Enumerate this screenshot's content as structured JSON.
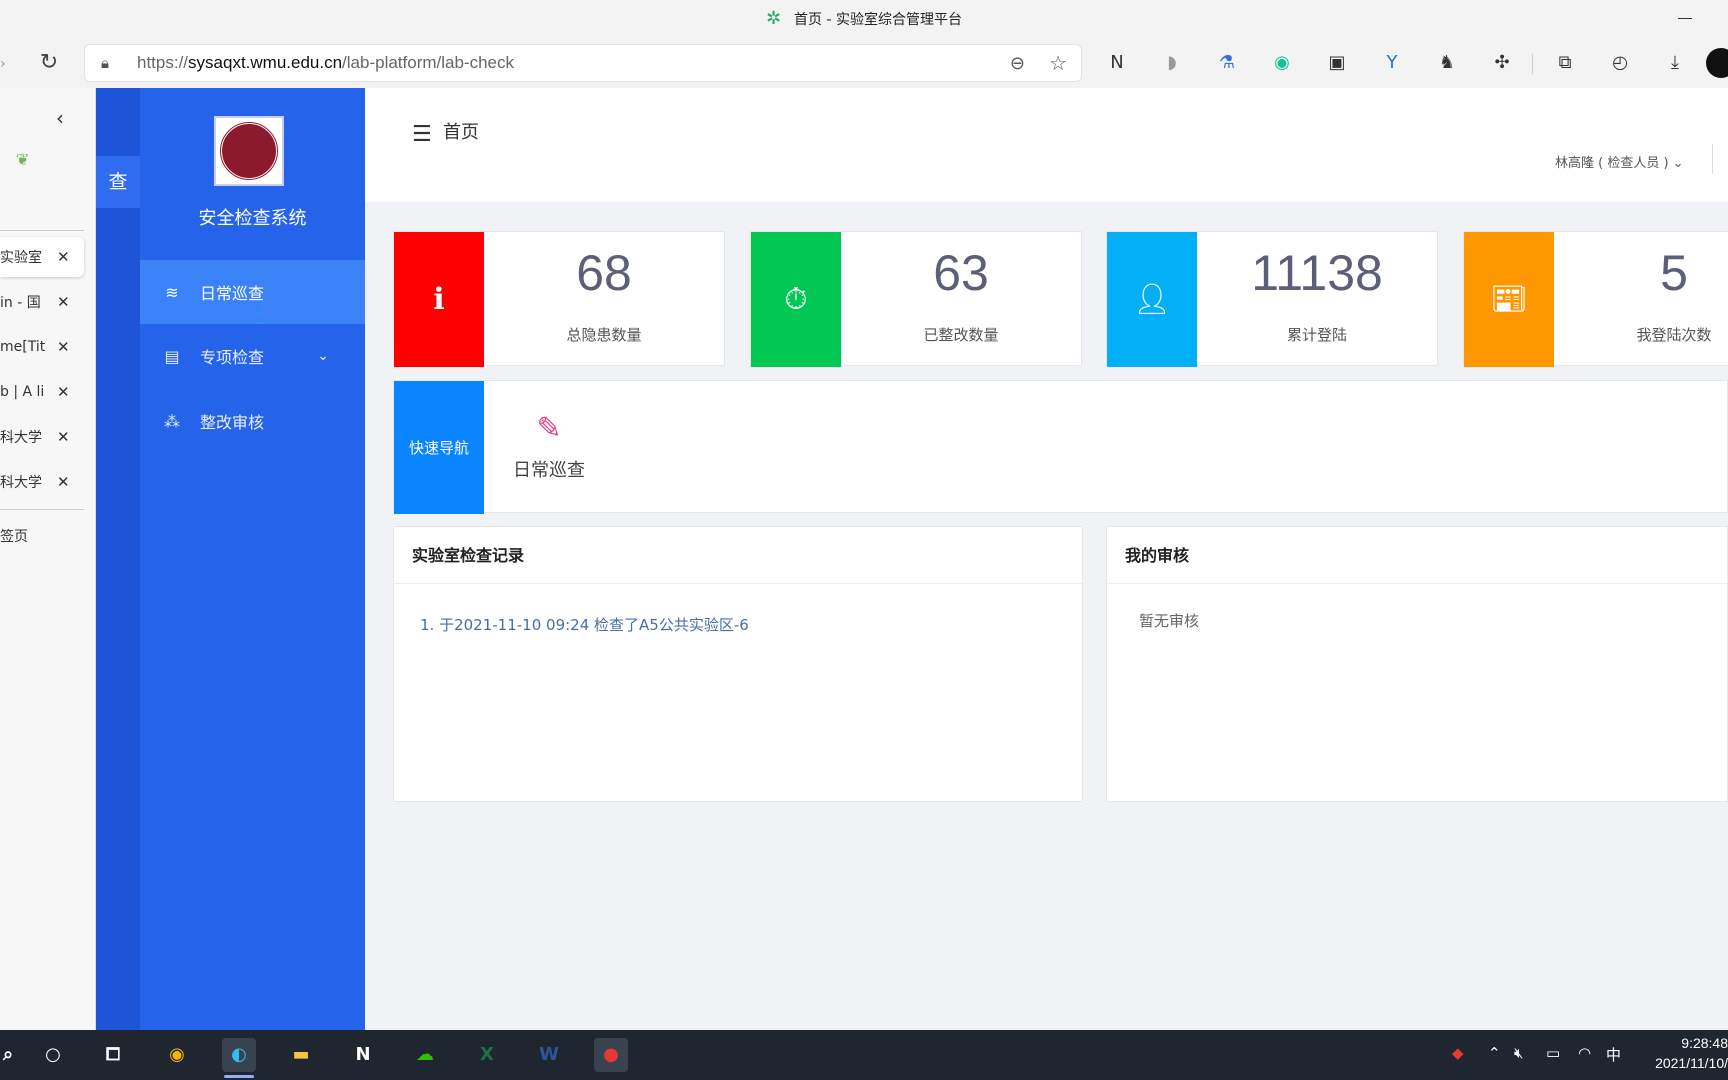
{
  "window": {
    "title": "首页 - 实验室综合管理平台"
  },
  "browser": {
    "url_prefix": "https://",
    "url_host": "sysaqxt.wmu.edu.cn",
    "url_path": "/lab-platform/lab-check"
  },
  "vertical_tabs": [
    {
      "label": "实验室",
      "active": true
    },
    {
      "label": "in - 国"
    },
    {
      "label": "me[Tit"
    },
    {
      "label": "b | A li"
    },
    {
      "label": "科大学"
    },
    {
      "label": "科大学"
    }
  ],
  "new_tab_label": "签页",
  "strip": {
    "chip_label": "查"
  },
  "sidebar": {
    "system_title": "安全检查系统",
    "items": [
      {
        "label": "日常巡查",
        "icon": "layers-icon",
        "active": true
      },
      {
        "label": "专项检查",
        "icon": "clipboard-icon",
        "expandable": true
      },
      {
        "label": "整改审核",
        "icon": "network-icon"
      }
    ]
  },
  "header": {
    "breadcrumb": "首页",
    "user": "林高隆 ( 检查人员 ) ⌄"
  },
  "stats": [
    {
      "value": "68",
      "label": "总隐患数量",
      "color": "#ff0000",
      "icon": "info-icon"
    },
    {
      "value": "63",
      "label": "已整改数量",
      "color": "#00c853",
      "icon": "timer-icon"
    },
    {
      "value": "11138",
      "label": "累计登陆",
      "color": "#03b0f5",
      "icon": "user-icon"
    },
    {
      "value": "5",
      "label": "我登陆次数",
      "color": "#ff9800",
      "icon": "news-icon"
    }
  ],
  "quick_nav": {
    "title": "快速导航",
    "items": [
      {
        "label": "日常巡查",
        "icon": "edit-icon"
      }
    ]
  },
  "panels": {
    "records": {
      "title": "实验室检查记录",
      "items": [
        "1. 于2021-11-10 09:24 检查了A5公共实验区-6"
      ]
    },
    "reviews": {
      "title": "我的审核",
      "empty": "暂无审核"
    }
  },
  "taskbar": {
    "tray_ime": "中",
    "time": "9:28:48",
    "date": "2021/11/10/"
  }
}
